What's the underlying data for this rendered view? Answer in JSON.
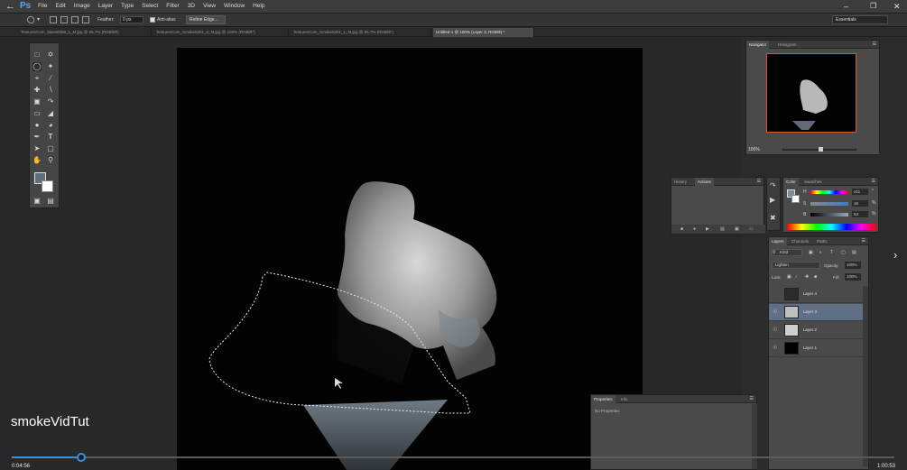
{
  "app": {
    "logo": "Ps",
    "back_icon": "back-arrow-icon"
  },
  "menu": [
    "File",
    "Edit",
    "Image",
    "Layer",
    "Type",
    "Select",
    "Filter",
    "3D",
    "View",
    "Window",
    "Help"
  ],
  "window_controls": {
    "minimize": "–",
    "maximize": "❐",
    "close": "✕"
  },
  "options_bar": {
    "feather_label": "Feather:",
    "feather_value": "0 px",
    "anti_alias_label": "Anti-alias",
    "refine_edge_label": "Refine Edge...",
    "workspace": "Essentials"
  },
  "doc_tabs": [
    {
      "label": "TexturesCom_Skies0058_1_M.jpg @ 66.7% (RGB/8#)"
    },
    {
      "label": "TexturesCom_Smoke0401_6_M.jpg @ 100% (RGB/8*)"
    },
    {
      "label": "TexturesCom_Smoke0401_1_M.jpg @ 66.7% (RGB/8*)"
    },
    {
      "label": "Untitled-1 @ 100% (Layer 3, RGB/8) *"
    }
  ],
  "navigator": {
    "tabs": [
      "Navigator",
      "Histogram"
    ],
    "zoom": "100%",
    "accent": "#e0503a"
  },
  "history": {
    "tabs": [
      "History",
      "Actions"
    ]
  },
  "color_panel": {
    "tabs": [
      "Color",
      "Swatches"
    ],
    "h_label": "H",
    "h_value": "211",
    "s_label": "S",
    "s_value": "16",
    "b_label": "B",
    "b_value": "53",
    "pct": "%",
    "deg": "°"
  },
  "layers_panel": {
    "tabs": [
      "Layers",
      "Channels",
      "Paths"
    ],
    "kind_label": "Kind",
    "blend_mode": "Lighten",
    "opacity_label": "Opacity:",
    "opacity_value": "100%",
    "lock_label": "Lock:",
    "fill_label": "Fill:",
    "fill_value": "100%",
    "layers": [
      {
        "name": "Layer 4",
        "visible": false,
        "selected": false
      },
      {
        "name": "Layer 3",
        "visible": true,
        "selected": true
      },
      {
        "name": "Layer 2",
        "visible": true,
        "selected": false
      },
      {
        "name": "Layer 1",
        "visible": true,
        "selected": false
      }
    ]
  },
  "properties_panel": {
    "tabs": [
      "Properties",
      "Info"
    ],
    "body": "No Properties"
  },
  "video": {
    "title": "smokeVidTut",
    "current_time": "0:04:56",
    "total_time": "1:00:53",
    "progress": 0.079
  }
}
